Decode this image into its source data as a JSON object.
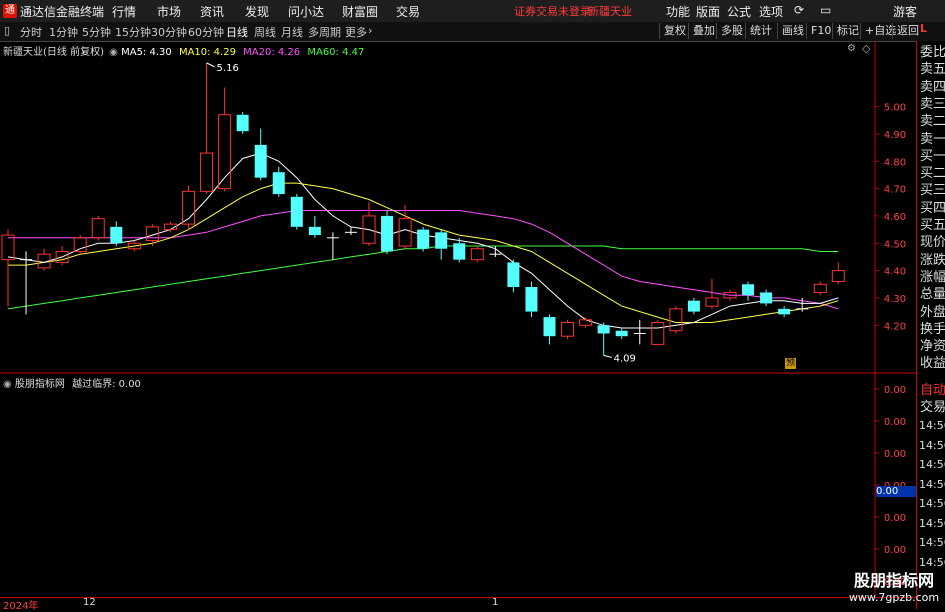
{
  "app": {
    "logo_text": "通",
    "title": "通达信金融终端"
  },
  "menu": [
    "行情",
    "市场",
    "资讯",
    "发现",
    "问小达",
    "财富圈",
    "交易"
  ],
  "notice": {
    "warn": "证券交易未登录",
    "stock": "新疆天业"
  },
  "right_menu": [
    "功能",
    "版面",
    "公式",
    "选项"
  ],
  "guest": "游客",
  "periods": [
    "分时",
    "1分钟",
    "5分钟",
    "15分钟",
    "30分钟",
    "60分钟",
    "日线",
    "周线",
    "月线",
    "多周期",
    "更多"
  ],
  "active_period": "日线",
  "tool_buttons": [
    "复权",
    "叠加",
    "多股",
    "统计",
    "画线",
    "F10",
    "标记",
    "+自选",
    "返回"
  ],
  "main_legend": {
    "name": "新疆天业(日线 前复权)",
    "ma5": "MA5: 4.30",
    "ma10": "MA10: 4.29",
    "ma20": "MA20: 4.26",
    "ma60": "MA60: 4.47"
  },
  "sub_legend": {
    "name": "股朋指标网",
    "label": "越过临界: 0.00"
  },
  "right_panel": {
    "items": [
      "委比",
      "卖五",
      "卖四",
      "卖三",
      "卖二",
      "卖一",
      "买一",
      "买二",
      "买三",
      "买四",
      "买五",
      "现价",
      "涨跌",
      "涨幅",
      "总量",
      "外盘",
      "换手",
      "净资",
      "收益"
    ],
    "bottom_items": [
      "自动",
      "交易"
    ],
    "times": [
      "14:56",
      "14:56",
      "14:56",
      "14:56",
      "14:56",
      "14:56",
      "14:56",
      "14:56"
    ],
    "top_label": "L"
  },
  "sub_value_box": "0.00",
  "pre_badge": "预",
  "watermark": {
    "line1": "股朋指标网",
    "line2": "www.7gpzb.com"
  },
  "timeline": {
    "year": "2024年",
    "dec": "12",
    "jan": "1"
  },
  "colors": {
    "up": "#ff3232",
    "down": "#54ffff",
    "ma5": "#ffffff",
    "ma10": "#ffff40",
    "ma20": "#ff50ff",
    "ma60": "#40ff40",
    "axis": "#c00000"
  },
  "chart_data": {
    "type": "candlestick",
    "price_axis_ticks": [
      5.0,
      4.9,
      4.8,
      4.7,
      4.6,
      4.5,
      4.4,
      4.3,
      4.2
    ],
    "sub_axis_ticks": [
      "0.00",
      "0.00",
      "0.00",
      "0.00",
      "0.00",
      "0.00",
      "0.00"
    ],
    "ylim": [
      4.04,
      5.24
    ],
    "max_label": "5.16",
    "min_label": "4.09",
    "candles": [
      {
        "o": 4.44,
        "c": 4.53,
        "h": 4.55,
        "l": 4.27
      },
      {
        "o": 4.44,
        "c": 4.44,
        "h": 4.47,
        "l": 4.24
      },
      {
        "o": 4.41,
        "c": 4.46,
        "h": 4.48,
        "l": 4.4
      },
      {
        "o": 4.43,
        "c": 4.47,
        "h": 4.49,
        "l": 4.42
      },
      {
        "o": 4.47,
        "c": 4.52,
        "h": 4.53,
        "l": 4.46
      },
      {
        "o": 4.52,
        "c": 4.59,
        "h": 4.6,
        "l": 4.51
      },
      {
        "o": 4.56,
        "c": 4.5,
        "h": 4.58,
        "l": 4.49
      },
      {
        "o": 4.48,
        "c": 4.5,
        "h": 4.51,
        "l": 4.47
      },
      {
        "o": 4.51,
        "c": 4.56,
        "h": 4.57,
        "l": 4.49
      },
      {
        "o": 4.55,
        "c": 4.57,
        "h": 4.58,
        "l": 4.54
      },
      {
        "o": 4.57,
        "c": 4.69,
        "h": 4.71,
        "l": 4.55
      },
      {
        "o": 4.69,
        "c": 4.83,
        "h": 5.16,
        "l": 4.68
      },
      {
        "o": 4.7,
        "c": 4.97,
        "h": 5.07,
        "l": 4.69
      },
      {
        "o": 4.97,
        "c": 4.91,
        "h": 4.98,
        "l": 4.9
      },
      {
        "o": 4.86,
        "c": 4.74,
        "h": 4.92,
        "l": 4.73
      },
      {
        "o": 4.76,
        "c": 4.68,
        "h": 4.78,
        "l": 4.67
      },
      {
        "o": 4.67,
        "c": 4.56,
        "h": 4.68,
        "l": 4.55
      },
      {
        "o": 4.56,
        "c": 4.53,
        "h": 4.6,
        "l": 4.52
      },
      {
        "o": 4.52,
        "c": 4.52,
        "h": 4.54,
        "l": 4.44
      },
      {
        "o": 4.54,
        "c": 4.54,
        "h": 4.56,
        "l": 4.53
      },
      {
        "o": 4.5,
        "c": 4.6,
        "h": 4.65,
        "l": 4.49
      },
      {
        "o": 4.6,
        "c": 4.47,
        "h": 4.62,
        "l": 4.46
      },
      {
        "o": 4.49,
        "c": 4.59,
        "h": 4.64,
        "l": 4.48
      },
      {
        "o": 4.55,
        "c": 4.48,
        "h": 4.56,
        "l": 4.47
      },
      {
        "o": 4.54,
        "c": 4.48,
        "h": 4.55,
        "l": 4.44
      },
      {
        "o": 4.5,
        "c": 4.44,
        "h": 4.52,
        "l": 4.43
      },
      {
        "o": 4.44,
        "c": 4.48,
        "h": 4.49,
        "l": 4.43
      },
      {
        "o": 4.46,
        "c": 4.46,
        "h": 4.49,
        "l": 4.45
      },
      {
        "o": 4.43,
        "c": 4.34,
        "h": 4.44,
        "l": 4.32
      },
      {
        "o": 4.34,
        "c": 4.25,
        "h": 4.36,
        "l": 4.23
      },
      {
        "o": 4.23,
        "c": 4.16,
        "h": 4.24,
        "l": 4.13
      },
      {
        "o": 4.16,
        "c": 4.21,
        "h": 4.22,
        "l": 4.15
      },
      {
        "o": 4.2,
        "c": 4.22,
        "h": 4.23,
        "l": 4.19
      },
      {
        "o": 4.2,
        "c": 4.17,
        "h": 4.21,
        "l": 4.09
      },
      {
        "o": 4.18,
        "c": 4.16,
        "h": 4.19,
        "l": 4.15
      },
      {
        "o": 4.17,
        "c": 4.17,
        "h": 4.22,
        "l": 4.13
      },
      {
        "o": 4.13,
        "c": 4.21,
        "h": 4.22,
        "l": 4.13
      },
      {
        "o": 4.18,
        "c": 4.26,
        "h": 4.27,
        "l": 4.17
      },
      {
        "o": 4.29,
        "c": 4.25,
        "h": 4.3,
        "l": 4.24
      },
      {
        "o": 4.27,
        "c": 4.3,
        "h": 4.37,
        "l": 4.26
      },
      {
        "o": 4.3,
        "c": 4.32,
        "h": 4.33,
        "l": 4.29
      },
      {
        "o": 4.35,
        "c": 4.31,
        "h": 4.36,
        "l": 4.29
      },
      {
        "o": 4.32,
        "c": 4.28,
        "h": 4.33,
        "l": 4.27
      },
      {
        "o": 4.26,
        "c": 4.24,
        "h": 4.27,
        "l": 4.23
      },
      {
        "o": 4.26,
        "c": 4.26,
        "h": 4.3,
        "l": 4.25
      },
      {
        "o": 4.32,
        "c": 4.35,
        "h": 4.36,
        "l": 4.31
      },
      {
        "o": 4.36,
        "c": 4.4,
        "h": 4.43,
        "l": 4.35
      }
    ],
    "ma5": [
      4.45,
      4.44,
      4.43,
      4.45,
      4.48,
      4.5,
      4.5,
      4.51,
      4.53,
      4.55,
      4.59,
      4.66,
      4.74,
      4.81,
      4.83,
      4.8,
      4.74,
      4.66,
      4.6,
      4.56,
      4.55,
      4.53,
      4.55,
      4.53,
      4.52,
      4.51,
      4.5,
      4.48,
      4.43,
      4.39,
      4.33,
      4.27,
      4.22,
      4.2,
      4.19,
      4.19,
      4.19,
      4.2,
      4.21,
      4.24,
      4.27,
      4.28,
      4.29,
      4.29,
      4.28,
      4.28,
      4.3
    ],
    "ma10": [
      4.42,
      4.42,
      4.43,
      4.44,
      4.46,
      4.47,
      4.48,
      4.49,
      4.5,
      4.52,
      4.55,
      4.59,
      4.63,
      4.67,
      4.7,
      4.72,
      4.72,
      4.71,
      4.7,
      4.68,
      4.66,
      4.63,
      4.6,
      4.57,
      4.55,
      4.53,
      4.52,
      4.51,
      4.49,
      4.47,
      4.43,
      4.39,
      4.35,
      4.31,
      4.27,
      4.25,
      4.23,
      4.21,
      4.21,
      4.21,
      4.22,
      4.23,
      4.24,
      4.25,
      4.26,
      4.27,
      4.29
    ],
    "ma20": [
      4.52,
      4.52,
      4.52,
      4.52,
      4.52,
      4.52,
      4.52,
      4.52,
      4.52,
      4.52,
      4.53,
      4.54,
      4.56,
      4.58,
      4.6,
      4.61,
      4.62,
      4.62,
      4.62,
      4.62,
      4.62,
      4.62,
      4.62,
      4.62,
      4.62,
      4.62,
      4.61,
      4.6,
      4.59,
      4.57,
      4.54,
      4.5,
      4.46,
      4.42,
      4.38,
      4.36,
      4.35,
      4.34,
      4.33,
      4.32,
      4.31,
      4.31,
      4.3,
      4.3,
      4.29,
      4.28,
      4.26
    ],
    "ma60": [
      4.26,
      4.27,
      4.28,
      4.29,
      4.3,
      4.31,
      4.32,
      4.33,
      4.34,
      4.35,
      4.36,
      4.37,
      4.38,
      4.39,
      4.4,
      4.41,
      4.42,
      4.43,
      4.44,
      4.45,
      4.46,
      4.47,
      4.48,
      4.48,
      4.49,
      4.49,
      4.49,
      4.49,
      4.49,
      4.49,
      4.49,
      4.49,
      4.49,
      4.49,
      4.48,
      4.48,
      4.48,
      4.48,
      4.48,
      4.48,
      4.48,
      4.48,
      4.48,
      4.48,
      4.48,
      4.47,
      4.47
    ]
  }
}
